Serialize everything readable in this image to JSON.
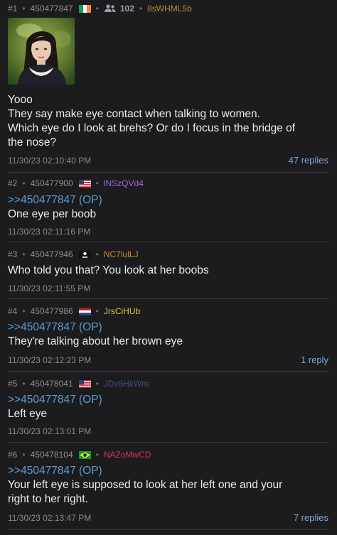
{
  "posts": [
    {
      "no": "#1",
      "id": "450477847",
      "flag": "ireland",
      "posters": "102",
      "uid": "8sWHML5b",
      "uid_color": "#b58a3e",
      "lines": [
        "Yooo",
        "They say make eye contact when talking to women.",
        "Which eye do I look at brehs? Or do I focus in the bridge of",
        "the nose?"
      ],
      "time": "11/30/23 02:10:40 PM",
      "replies": "47 replies"
    },
    {
      "no": "#2",
      "id": "450477900",
      "flag": "usa",
      "uid": "lNSzQVd4",
      "uid_color": "#a066d6",
      "quote": ">>450477847 (OP)",
      "text": "One eye per boob",
      "time": "11/30/23 02:11:16 PM"
    },
    {
      "no": "#3",
      "id": "450477946",
      "flag": "pirate",
      "uid": "NC7lulLJ",
      "uid_color": "#c98a2e",
      "text": "Who told you that? You look at her boobs",
      "time": "11/30/23 02:11:55 PM"
    },
    {
      "no": "#4",
      "id": "450477986",
      "flag": "netherlands",
      "uid": "JrsCiHUb",
      "uid_color": "#e2c23c",
      "quote": ">>450477847 (OP)",
      "text": "They're talking about her brown eye",
      "time": "11/30/23 02:12:23 PM",
      "replies": "1 reply"
    },
    {
      "no": "#5",
      "id": "450478041",
      "flag": "usa",
      "uid": "JDx6HkWm",
      "uid_color": "#3d4f8c",
      "quote": ">>450477847 (OP)",
      "text": "Left eye",
      "time": "11/30/23 02:13:01 PM"
    },
    {
      "no": "#6",
      "id": "450478104",
      "flag": "brazil",
      "uid": "NAZoMwCD",
      "uid_color": "#d9344e",
      "quote": ">>450477847 (OP)",
      "lines": [
        "Your left eye is supposed to look at her left one and your",
        "right to her right."
      ],
      "time": "11/30/23 02:13:47 PM",
      "replies": "7 replies"
    }
  ]
}
